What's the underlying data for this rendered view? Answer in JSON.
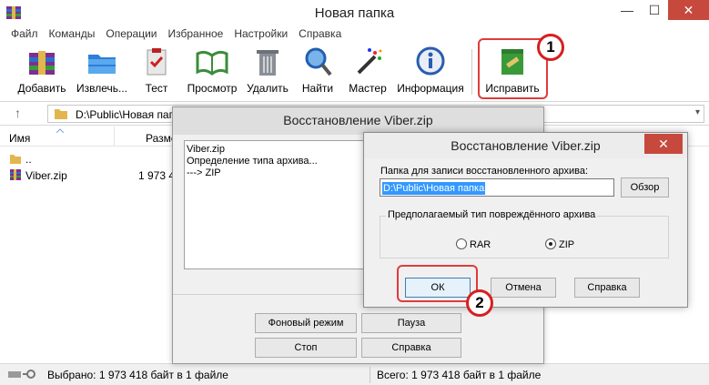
{
  "window": {
    "title": "Новая папка",
    "minimize": "—",
    "maximize": "☐",
    "close": "✕"
  },
  "menu": [
    "Файл",
    "Команды",
    "Операции",
    "Избранное",
    "Настройки",
    "Справка"
  ],
  "toolbar": {
    "add": "Добавить",
    "extract": "Извлечь...",
    "test": "Тест",
    "view": "Просмотр",
    "delete": "Удалить",
    "find": "Найти",
    "wizard": "Мастер",
    "info": "Информация",
    "repair": "Исправить"
  },
  "address": {
    "path": "D:\\Public\\Новая папка",
    "up": "↑",
    "dropdown": "▾"
  },
  "columns": {
    "name": "Имя",
    "size": "Разме"
  },
  "files": [
    {
      "name": "..",
      "size": ""
    },
    {
      "name": "Viber.zip",
      "size": "1 973 4"
    }
  ],
  "status": {
    "selected": "Выбрано: 1 973 418 байт в 1 файле",
    "total": "Всего: 1 973 418 байт в 1 файле"
  },
  "dialog_progress": {
    "title": "Восстановление Viber.zip",
    "log": [
      "Viber.zip",
      "Определение типа архива...",
      "---> ZIP"
    ],
    "background": "Фоновый режим",
    "pause": "Пауза",
    "stop": "Стоп",
    "help": "Справка"
  },
  "dialog_repair": {
    "title": "Восстановление Viber.zip",
    "close": "✕",
    "folder_label": "Папка для записи восстановленного архива:",
    "folder_value": "D:\\Public\\Новая папка",
    "browse": "Обзор",
    "group_title": "Предполагаемый тип повреждённого архива",
    "type_rar": "RAR",
    "type_zip": "ZIP",
    "selected_type": "ZIP",
    "ok": "ОК",
    "cancel": "Отмена",
    "help": "Справка"
  },
  "badges": {
    "one": "1",
    "two": "2"
  },
  "colors": {
    "highlight": "#e03b3b",
    "selection": "#3399ff",
    "close_red": "#c7493d"
  }
}
